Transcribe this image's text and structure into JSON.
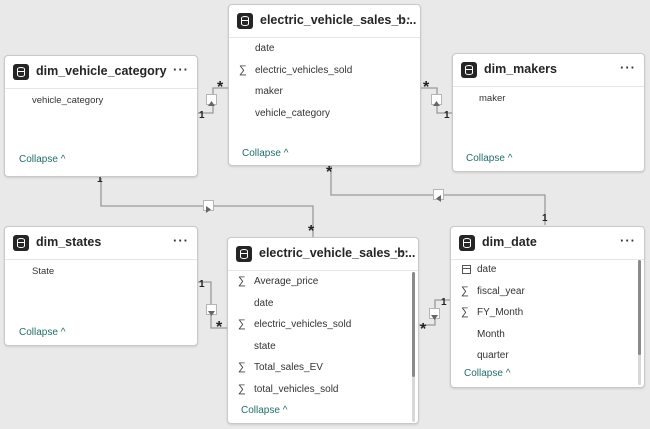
{
  "tables": {
    "dim_vehicle_category": {
      "title": "dim_vehicle_category",
      "fields": [
        {
          "name": "vehicle_category",
          "icon": "none"
        }
      ],
      "collapse": "Collapse"
    },
    "ev_sales_top": {
      "title": "electric_vehicle_sales_b...",
      "fields": [
        {
          "name": "date",
          "icon": "none"
        },
        {
          "name": "electric_vehicles_sold",
          "icon": "sigma"
        },
        {
          "name": "maker",
          "icon": "none"
        },
        {
          "name": "vehicle_category",
          "icon": "none"
        }
      ],
      "collapse": "Collapse"
    },
    "dim_makers": {
      "title": "dim_makers",
      "fields": [
        {
          "name": "maker",
          "icon": "none"
        }
      ],
      "collapse": "Collapse"
    },
    "dim_states": {
      "title": "dim_states",
      "fields": [
        {
          "name": "State",
          "icon": "none"
        }
      ],
      "collapse": "Collapse"
    },
    "ev_sales_bottom": {
      "title": "electric_vehicle_sales_b...",
      "fields": [
        {
          "name": "Average_price",
          "icon": "sigma"
        },
        {
          "name": "date",
          "icon": "none"
        },
        {
          "name": "electric_vehicles_sold",
          "icon": "sigma"
        },
        {
          "name": "state",
          "icon": "none"
        },
        {
          "name": "Total_sales_EV",
          "icon": "sigma"
        },
        {
          "name": "total_vehicles_sold",
          "icon": "sigma"
        }
      ],
      "collapse": "Collapse"
    },
    "dim_date": {
      "title": "dim_date",
      "fields": [
        {
          "name": "date",
          "icon": "calendar"
        },
        {
          "name": "fiscal_year",
          "icon": "sigma"
        },
        {
          "name": "FY_Month",
          "icon": "sigma"
        },
        {
          "name": "Month",
          "icon": "none"
        },
        {
          "name": "quarter",
          "icon": "none"
        }
      ],
      "collapse": "Collapse"
    }
  },
  "relationships": {
    "one": "1",
    "many": "*"
  }
}
